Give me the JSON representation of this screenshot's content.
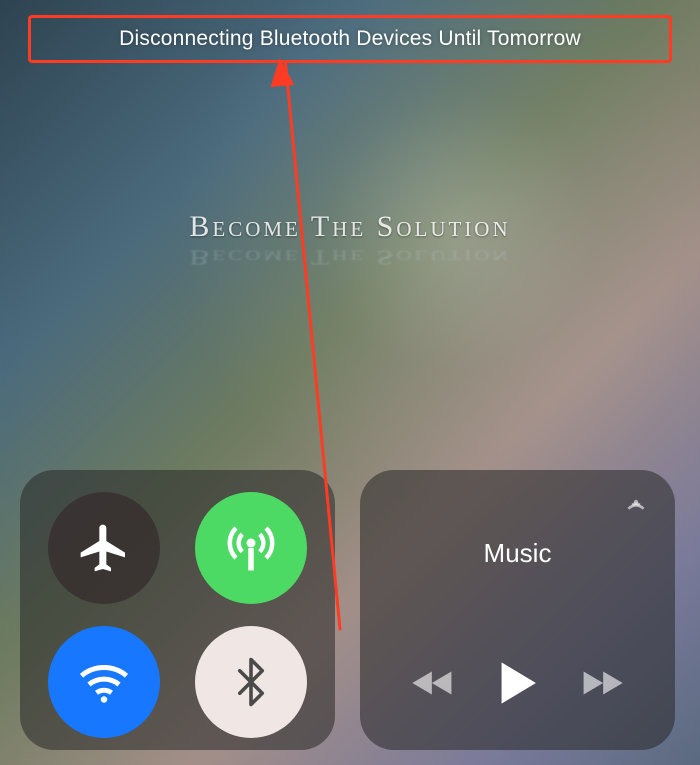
{
  "status_banner": "Disconnecting Bluetooth Devices Until Tomorrow",
  "watermark": "Become The Solution",
  "connectivity": {
    "airplane_mode": {
      "icon": "airplane-icon",
      "active": false
    },
    "cellular": {
      "icon": "cellular-antenna-icon",
      "active": true,
      "color": "#4cd964"
    },
    "wifi": {
      "icon": "wifi-icon",
      "active": true,
      "color": "#1778ff"
    },
    "bluetooth": {
      "icon": "bluetooth-icon",
      "active": false,
      "color": "#f0e7e4"
    }
  },
  "music": {
    "title": "Music",
    "prev_icon": "rewind-icon",
    "play_icon": "play-icon",
    "next_icon": "forward-icon",
    "airplay_icon": "airplay-icon"
  },
  "annotation": {
    "highlight_color": "#ff3b24",
    "arrow_color": "#ff3b24"
  }
}
